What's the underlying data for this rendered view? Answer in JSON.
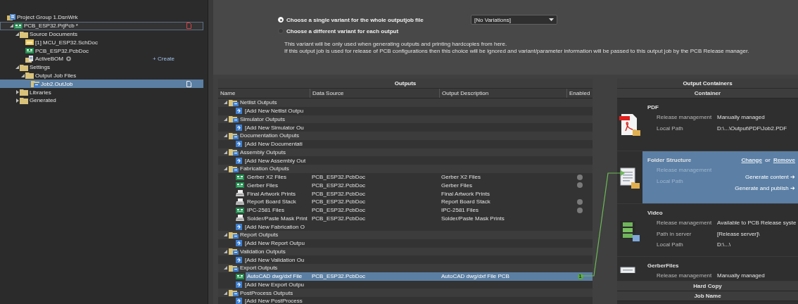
{
  "tree": {
    "label": "Project Group 1.DsnWrk",
    "kind": "group",
    "selected": false,
    "children": [
      {
        "label": "PCB_ESP32.PrjPcb *",
        "kind": "project",
        "expanded": true,
        "focused": true,
        "selected": false,
        "modified": true,
        "children": [
          {
            "label": "Source Documents",
            "kind": "folder",
            "expanded": true,
            "selected": false,
            "children": [
              {
                "label": "[1] MCU_ESP32.SchDoc",
                "kind": "schdoc",
                "selected": false
              },
              {
                "label": "PCB_ESP32.PcbDoc",
                "kind": "pcbdoc",
                "selected": false
              },
              {
                "label": "ActiveBOM",
                "kind": "bom",
                "help": true,
                "action": "+ Create",
                "selected": false
              }
            ]
          },
          {
            "label": "Settings",
            "kind": "folder",
            "expanded": true,
            "selected": false,
            "children": [
              {
                "label": "Output Job Files",
                "kind": "folder",
                "expanded": true,
                "selected": false,
                "children": [
                  {
                    "label": "Job2.OutJob",
                    "kind": "outjob",
                    "selected": true,
                    "modified": false
                  }
                ]
              }
            ]
          },
          {
            "label": "Libraries",
            "kind": "folder",
            "expanded": false,
            "selected": false
          },
          {
            "label": "Generated",
            "kind": "folder",
            "expanded": false,
            "selected": false
          }
        ]
      }
    ]
  },
  "variants": {
    "options": [
      {
        "label": "Choose a single variant for the whole outputjob file",
        "selected": true
      },
      {
        "label": "Choose a different variant for each output",
        "selected": false
      }
    ],
    "dropdown": {
      "value": "[No Variations]"
    },
    "note": [
      "This variant will be only used when generating outputs and printing hardcopies from here.",
      "If this output job is used for release of PCB configurations then this choice will be ignored and variant/parameter information will be passed to this output job by the PCB Release manager."
    ]
  },
  "outputs": {
    "title": "Outputs",
    "columns": [
      "Name",
      "Data Source",
      "Output Description",
      "Enabled"
    ],
    "groups": [
      {
        "name": "Netlist Outputs",
        "expanded": true,
        "items": [
          {
            "kind": "add",
            "name": "[Add New Netlist Outpu",
            "selected": false
          }
        ]
      },
      {
        "name": "Simulator Outputs",
        "expanded": true,
        "items": [
          {
            "kind": "add",
            "name": "[Add New Simulator Ou",
            "selected": false
          }
        ]
      },
      {
        "name": "Documentation Outputs",
        "expanded": true,
        "items": [
          {
            "kind": "add",
            "name": "[Add New Documentati",
            "selected": false
          }
        ]
      },
      {
        "name": "Assembly Outputs",
        "expanded": true,
        "items": [
          {
            "kind": "add",
            "name": "[Add New Assembly Out",
            "selected": false
          }
        ]
      },
      {
        "name": "Fabrication Outputs",
        "expanded": true,
        "items": [
          {
            "kind": "pcb_output",
            "name": "Gerber X2 Files",
            "source": "PCB_ESP32.PcbDoc",
            "description": "Gerber X2 Files",
            "enabled": true,
            "selected": false
          },
          {
            "kind": "pcb_output",
            "name": "Gerber Files",
            "source": "PCB_ESP32.PcbDoc",
            "description": "Gerber Files",
            "enabled": true,
            "selected": false
          },
          {
            "kind": "print_output",
            "name": "Final Artwork Prints",
            "source": "PCB_ESP32.PcbDoc",
            "description": "Final Artwork Prints",
            "enabled": false,
            "selected": false
          },
          {
            "kind": "print_output",
            "name": "Report Board Stack",
            "source": "PCB_ESP32.PcbDoc",
            "description": "Report Board Stack",
            "enabled": true,
            "selected": false
          },
          {
            "kind": "pcb_output",
            "name": "IPC-2581 Files",
            "source": "PCB_ESP32.PcbDoc",
            "description": "IPC-2581 Files",
            "enabled": true,
            "selected": false
          },
          {
            "kind": "print_output",
            "name": "Solder/Paste Mask Print",
            "source": "PCB_ESP32.PcbDoc",
            "description": "Solder/Paste Mask Prints",
            "enabled": false,
            "selected": false
          },
          {
            "kind": "add",
            "name": "[Add New Fabrication O",
            "selected": false
          }
        ]
      },
      {
        "name": "Report Outputs",
        "expanded": true,
        "items": [
          {
            "kind": "add",
            "name": "[Add New Report Outpu",
            "selected": false
          }
        ]
      },
      {
        "name": "Validation Outputs",
        "expanded": true,
        "items": [
          {
            "kind": "add",
            "name": "[Add New Validation Ou",
            "selected": false
          }
        ]
      },
      {
        "name": "Export Outputs",
        "expanded": true,
        "items": [
          {
            "kind": "pcb_output",
            "name": "AutoCAD dwg/dxf File",
            "source": "PCB_ESP32.PcbDoc",
            "description": "AutoCAD dwg/dxf File PCB",
            "enabled": true,
            "container": "1",
            "selected": true
          },
          {
            "kind": "add",
            "name": "[Add New Export Outpu",
            "selected": false
          }
        ]
      },
      {
        "name": "PostProcess Outputs",
        "expanded": true,
        "items": [
          {
            "kind": "add",
            "name": "[Add New PostProcess",
            "selected": false
          }
        ]
      }
    ]
  },
  "containers": {
    "title": "Output Containers",
    "column": "Container",
    "items": [
      {
        "name": "PDF",
        "kind": "pdf",
        "selected": false,
        "fields": [
          {
            "label": "Release management",
            "value": "Manually managed"
          },
          {
            "label": "Local Path",
            "value": "D:\\...\\Output\\PDF\\Job2.PDF"
          }
        ]
      },
      {
        "name": "Folder Structure",
        "kind": "folder_structure",
        "selected": true,
        "fields": [
          {
            "label": "Release management"
          },
          {
            "label": "Local Path"
          }
        ],
        "change_link": "Change",
        "separator": "or",
        "remove_link": "Remove",
        "actions": [
          "Generate content ➔",
          "Generate and publish ➔"
        ]
      },
      {
        "name": "Video",
        "kind": "video",
        "selected": false,
        "fields": [
          {
            "label": "Release management",
            "value": "Available to PCB Release syste"
          },
          {
            "label": "Path in server",
            "value": "[Release server]\\"
          },
          {
            "label": "Local Path",
            "value": "D:\\...\\"
          }
        ]
      },
      {
        "name": "GerberFiles",
        "kind": "plain",
        "selected": false,
        "fields": [
          {
            "label": "Release management",
            "value": "Manually managed"
          }
        ]
      }
    ],
    "hard_copy": {
      "title": "Hard Copy",
      "column": "Job Name"
    }
  }
}
